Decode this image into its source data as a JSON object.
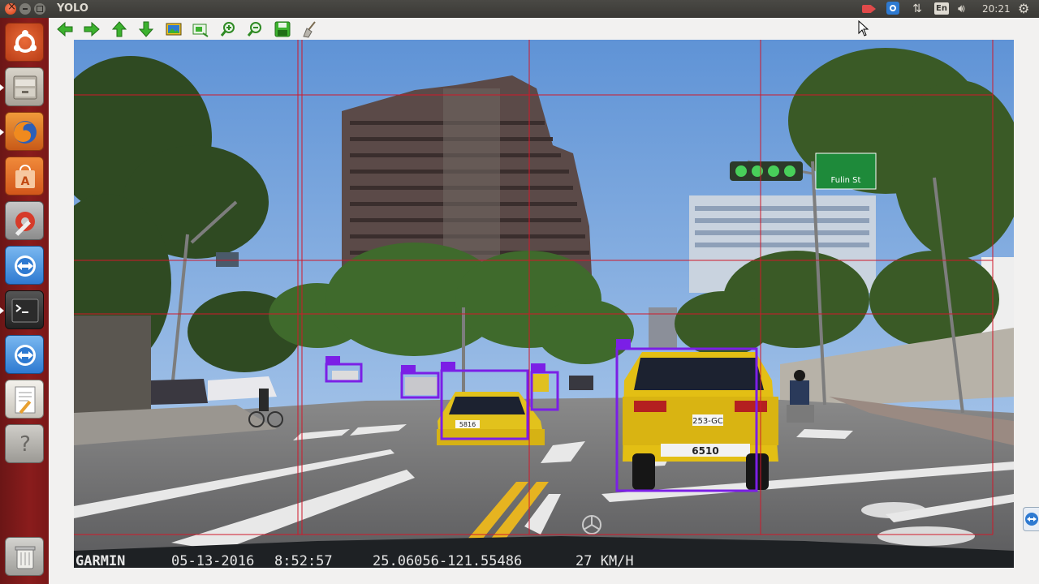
{
  "window": {
    "title": "YOLO"
  },
  "system_tray": {
    "keyboard_layout": "En",
    "clock": "20:21",
    "icons": [
      "record-icon",
      "teamviewer-icon",
      "network-icon",
      "keyboard-icon",
      "volume-icon",
      "settings-gear-icon"
    ]
  },
  "launcher": {
    "items": [
      {
        "name": "ubuntu-dash",
        "icon": "ubuntu-logo-icon",
        "color": "#e05a2a"
      },
      {
        "name": "files",
        "icon": "file-cabinet-icon",
        "color": "#c9c3b8"
      },
      {
        "name": "firefox",
        "icon": "firefox-icon",
        "color": "#e8772a"
      },
      {
        "name": "software-center",
        "icon": "shopping-bag-icon",
        "color": "#e86a2a"
      },
      {
        "name": "system-settings",
        "icon": "wrench-gear-icon",
        "color": "#b8b8b8"
      },
      {
        "name": "teamviewer",
        "icon": "teamviewer-icon",
        "color": "#2e7ad1"
      },
      {
        "name": "terminal",
        "icon": "terminal-icon",
        "color": "#3a3a3a"
      },
      {
        "name": "teamviewer-2",
        "icon": "teamviewer-icon",
        "color": "#2e7ad1"
      },
      {
        "name": "text-editor",
        "icon": "text-editor-icon",
        "color": "#e8e6e0"
      },
      {
        "name": "help",
        "icon": "help-icon",
        "color": "#b9b8b4"
      },
      {
        "name": "trash",
        "icon": "trash-icon",
        "color": "#c9c8c4"
      }
    ]
  },
  "toolbar": {
    "buttons": [
      {
        "name": "previous-button",
        "icon": "arrow-left-icon"
      },
      {
        "name": "next-button",
        "icon": "arrow-right-icon"
      },
      {
        "name": "up-button",
        "icon": "arrow-up-icon"
      },
      {
        "name": "down-button",
        "icon": "arrow-down-icon"
      },
      {
        "name": "open-image-button",
        "icon": "image-icon"
      },
      {
        "name": "fit-window-button",
        "icon": "fit-window-icon"
      },
      {
        "name": "zoom-in-button",
        "icon": "zoom-in-icon"
      },
      {
        "name": "zoom-out-button",
        "icon": "zoom-out-icon"
      },
      {
        "name": "save-button",
        "icon": "save-icon"
      },
      {
        "name": "clear-button",
        "icon": "broom-icon"
      }
    ],
    "accent_color": "#3cb22e"
  },
  "frame_overlay": {
    "brand": "GARMIN",
    "date": "05-13-2016",
    "time": "8:52:57",
    "coordinates": "25.06056-121.55486",
    "speed": "27 KM/H"
  },
  "scene": {
    "street_sign": "Fulin St",
    "license_plate_near": "253-GC",
    "license_plate_rear": "6510",
    "license_plate_mid": "5816"
  },
  "detections": {
    "color": "#7b1fe6",
    "grid_color": "#d0182a",
    "count": 6
  }
}
